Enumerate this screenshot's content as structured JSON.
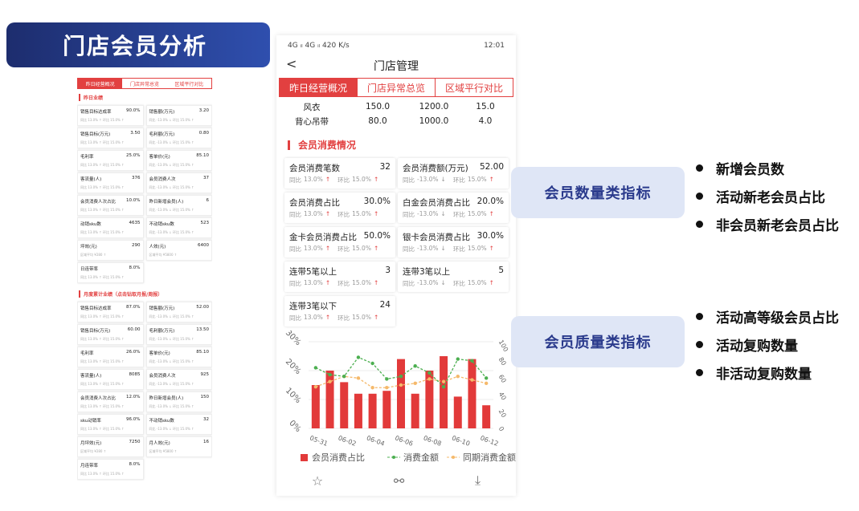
{
  "banner": {
    "title": "门店会员分析"
  },
  "thumb": {
    "tabs": [
      "昨日经营概况",
      "门店异常总览",
      "区域平行对比"
    ],
    "section1": "昨日业绩",
    "cards1": [
      {
        "label": "销售目标达成率",
        "value": "90.0%",
        "sub": "同比 13.0% ↑  环比 15.0% ↑"
      },
      {
        "label": "销售额(万元)",
        "value": "3.20",
        "sub": "同比 -13.0% ↓  环比 15.0% ↑"
      },
      {
        "label": "销售目标(万元)",
        "value": "3.50",
        "sub": "同比 13.0% ↑  环比 15.0% ↑"
      },
      {
        "label": "毛利额(万元)",
        "value": "0.80",
        "sub": "同比 -13.0% ↓  环比 15.0% ↑"
      },
      {
        "label": "毛利率",
        "value": "25.0%",
        "sub": "同比 13.0% ↑  环比 15.0% ↑"
      },
      {
        "label": "客单价(元)",
        "value": "85.10",
        "sub": "同比 -13.0% ↓  环比 15.0% ↑"
      },
      {
        "label": "客流量(人)",
        "value": "376",
        "sub": "同比 13.0% ↑  环比 15.0% ↑"
      },
      {
        "label": "会员消费人次",
        "value": "37",
        "sub": "同比 -13.0% ↓  环比 15.0% ↑"
      },
      {
        "label": "会员消费人次占比",
        "value": "10.0%",
        "sub": "同比 13.0% ↑  环比 15.0% ↑"
      },
      {
        "label": "昨日新增会员(人)",
        "value": "6",
        "sub": "同比 -13.0% ↓  环比 15.0% ↑"
      },
      {
        "label": "动销sku数",
        "value": "4635",
        "sub": "同比 13.0% ↑  环比 15.0% ↑"
      },
      {
        "label": "不动销sku数",
        "value": "523",
        "sub": "同比 -13.0% ↓  环比 15.0% ↑"
      },
      {
        "label": "坪效(元)",
        "value": "290",
        "sub": "区域平均 ¥280 ↑"
      },
      {
        "label": "人效(元)",
        "value": "6400",
        "sub": "区域平均 ¥5800 ↑"
      },
      {
        "label": "日连带率",
        "value": "8.0%",
        "sub": "同比 13.0% ↑  环比 15.0% ↑"
      }
    ],
    "section2": "月度累计业绩（点击钻取月报/周报）",
    "cards2": [
      {
        "label": "销售目标达成率",
        "value": "87.0%",
        "sub": "同比 13.0% ↑  环比 15.0% ↑"
      },
      {
        "label": "销售额(万元)",
        "value": "52.00",
        "sub": "同比 -13.0% ↓  环比 15.0% ↑"
      },
      {
        "label": "销售目标(万元)",
        "value": "60.00",
        "sub": "同比 13.0% ↑  环比 15.0% ↑"
      },
      {
        "label": "毛利额(万元)",
        "value": "13.50",
        "sub": "同比 -13.0% ↓  环比 15.0% ↑"
      },
      {
        "label": "毛利率",
        "value": "26.0%",
        "sub": "同比 13.0% ↑  环比 15.0% ↑"
      },
      {
        "label": "客单价(元)",
        "value": "85.10",
        "sub": "同比 -13.0% ↓  环比 15.0% ↑"
      },
      {
        "label": "客流量(人)",
        "value": "8085",
        "sub": "同比 13.0% ↑  环比 15.0% ↑"
      },
      {
        "label": "会员消费人次",
        "value": "925",
        "sub": "同比 -13.0% ↓  环比 15.0% ↑"
      },
      {
        "label": "会员消费人次占比",
        "value": "12.0%",
        "sub": "同比 13.0% ↑  环比 15.0% ↑"
      },
      {
        "label": "昨日新增会员(人)",
        "value": "150",
        "sub": "同比 -13.0% ↓  环比 15.0% ↑"
      },
      {
        "label": "sku动销率",
        "value": "96.0%",
        "sub": "同比 13.0% ↑  环比 15.0% ↑"
      },
      {
        "label": "不动销sku数",
        "value": "32",
        "sub": "同比 -13.0% ↓  环比 15.0% ↑"
      },
      {
        "label": "月坪效(元)",
        "value": "7250",
        "sub": "区域平均 ¥280 ↑"
      },
      {
        "label": "月人效(元)",
        "value": "16",
        "sub": "区域平均 ¥5800 ↑"
      },
      {
        "label": "月连带率",
        "value": "8.0%",
        "sub": "同比 13.0% ↑  环比 15.0% ↑"
      }
    ]
  },
  "phone": {
    "status_left": "4G ᵢₗ 4G ᵢₗ 420 K/s",
    "status_right": "12:01",
    "nav_title": "门店管理",
    "back": "<",
    "tabs": [
      "昨日经营概况",
      "门店异常总览",
      "区域平行对比"
    ],
    "rows": [
      {
        "name": "风衣",
        "a": "150.0",
        "b": "1200.0",
        "c": "15.0"
      },
      {
        "name": "背心吊带",
        "a": "80.0",
        "b": "1000.0",
        "c": "4.0"
      }
    ],
    "section": "会员消费情况",
    "cards": [
      {
        "label": "会员消费笔数",
        "value": "32",
        "yoy": "13.0%",
        "yoy_dir": "↑",
        "mom": "15.0%",
        "mom_dir": "↑"
      },
      {
        "label": "会员消费额(万元)",
        "value": "52.00",
        "yoy": "-13.0%",
        "yoy_dir": "↓",
        "mom": "15.0%",
        "mom_dir": "↑"
      },
      {
        "label": "会员消费占比",
        "value": "30.0%",
        "yoy": "13.0%",
        "yoy_dir": "↑",
        "mom": "15.0%",
        "mom_dir": "↑"
      },
      {
        "label": "白金会员消费占比",
        "value": "20.0%",
        "yoy": "-13.0%",
        "yoy_dir": "↓",
        "mom": "15.0%",
        "mom_dir": "↑"
      },
      {
        "label": "金卡会员消费占比",
        "value": "50.0%",
        "yoy": "13.0%",
        "yoy_dir": "↑",
        "mom": "15.0%",
        "mom_dir": "↑"
      },
      {
        "label": "银卡会员消费占比",
        "value": "30.0%",
        "yoy": "-13.0%",
        "yoy_dir": "↓",
        "mom": "15.0%",
        "mom_dir": "↑"
      },
      {
        "label": "连带5笔以上",
        "value": "3",
        "yoy": "13.0%",
        "yoy_dir": "↑",
        "mom": "15.0%",
        "mom_dir": "↑"
      },
      {
        "label": "连带3笔以上",
        "value": "5",
        "yoy": "-13.0%",
        "yoy_dir": "↓",
        "mom": "15.0%",
        "mom_dir": "↑"
      },
      {
        "label": "连带3笔以下",
        "value": "24",
        "yoy": "13.0%",
        "yoy_dir": "↑",
        "mom": "15.0%",
        "mom_dir": "↑"
      }
    ],
    "yoy_label": "同比",
    "mom_label": "环比"
  },
  "right": {
    "box1": "会员数量类指标",
    "bullets1": [
      "新增会员数",
      "活动新老会员占比",
      "非会员新老会员占比"
    ],
    "box2": "会员质量类指标",
    "bullets2": [
      "活动高等级会员占比",
      "活动复购数量",
      "非活动复购数量"
    ]
  },
  "colors": {
    "accent": "#e24040",
    "banner": "#233a8a",
    "box": "#dfe6f6",
    "line_green": "#4caf50",
    "line_orange": "#f5b96b"
  },
  "chart_data": {
    "type": "bar",
    "categories": [
      "05-31",
      "06-01",
      "06-02",
      "06-03",
      "06-04",
      "06-05",
      "06-06",
      "06-07",
      "06-08",
      "06-09",
      "06-10",
      "06-11",
      "06-12"
    ],
    "x_tick_labels": [
      "05-31",
      "06-02",
      "06-04",
      "06-06",
      "06-08",
      "06-10",
      "06-12"
    ],
    "left_ticks": [
      "0%",
      "10%",
      "20%",
      "30%"
    ],
    "right_ticks": [
      "0",
      "20",
      "40",
      "60",
      "80",
      "100"
    ],
    "ylim": [
      0,
      30
    ],
    "y2lim": [
      0,
      100
    ],
    "series": [
      {
        "name": "会员消费占比",
        "kind": "bar",
        "axis": "left",
        "values": [
          15,
          20,
          16,
          12,
          12,
          13,
          24,
          12,
          20,
          25,
          11,
          24,
          8
        ]
      },
      {
        "name": "消费金额",
        "kind": "line",
        "axis": "right",
        "values": [
          70,
          62,
          60,
          82,
          75,
          57,
          60,
          72,
          64,
          48,
          80,
          78,
          58
        ]
      },
      {
        "name": "同期消费金额",
        "kind": "line",
        "axis": "right",
        "values": [
          48,
          54,
          60,
          58,
          47,
          47,
          50,
          52,
          57,
          54,
          60,
          56,
          52
        ]
      }
    ],
    "legend_position": "bottom"
  }
}
